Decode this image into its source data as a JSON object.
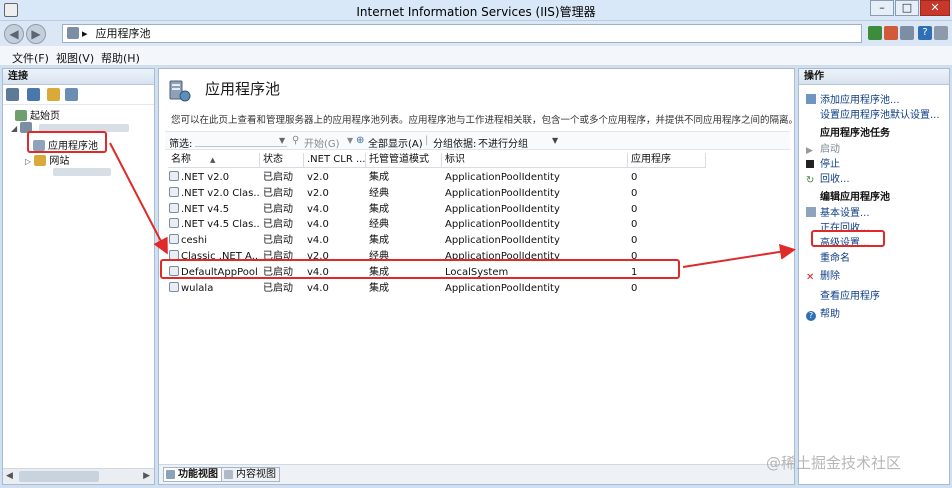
{
  "window": {
    "title": "Internet Information Services (IIS)管理器",
    "min": "–",
    "max": "□",
    "close": "✕"
  },
  "address": {
    "breadcrumb_sep": "▸",
    "path": "应用程序池"
  },
  "menu": [
    "文件(F)",
    "视图(V)",
    "帮助(H)"
  ],
  "connections": {
    "header": "连接",
    "tree": {
      "start_page": "起始页",
      "app_pools": "应用程序池",
      "sites": "网站"
    }
  },
  "main": {
    "title": "应用程序池",
    "description": "您可以在此页上查看和管理服务器上的应用程序池列表。应用程序池与工作进程相关联，包含一个或多个应用程序，并提供不同应用程序之间的隔离。",
    "filter": {
      "label": "筛选:",
      "start": "开始(G)",
      "show_all": "全部显示(A)",
      "group_by_label": "分组依据:",
      "group_by_value": "不进行分组"
    },
    "columns": [
      "名称",
      "状态",
      ".NET CLR ...",
      "托管管道模式",
      "标识",
      "应用程序"
    ],
    "rows": [
      {
        "name": ".NET v2.0",
        "status": "已启动",
        "clr": "v2.0",
        "pipeline": "集成",
        "identity": "ApplicationPoolIdentity",
        "apps": "0"
      },
      {
        "name": ".NET v2.0 Clas...",
        "status": "已启动",
        "clr": "v2.0",
        "pipeline": "经典",
        "identity": "ApplicationPoolIdentity",
        "apps": "0"
      },
      {
        "name": ".NET v4.5",
        "status": "已启动",
        "clr": "v4.0",
        "pipeline": "集成",
        "identity": "ApplicationPoolIdentity",
        "apps": "0"
      },
      {
        "name": ".NET v4.5 Clas...",
        "status": "已启动",
        "clr": "v4.0",
        "pipeline": "经典",
        "identity": "ApplicationPoolIdentity",
        "apps": "0"
      },
      {
        "name": "ceshi",
        "status": "已启动",
        "clr": "v4.0",
        "pipeline": "集成",
        "identity": "ApplicationPoolIdentity",
        "apps": "0"
      },
      {
        "name": "Classic .NET A...",
        "status": "已启动",
        "clr": "v2.0",
        "pipeline": "经典",
        "identity": "ApplicationPoolIdentity",
        "apps": "0"
      },
      {
        "name": "DefaultAppPool",
        "status": "已启动",
        "clr": "v4.0",
        "pipeline": "集成",
        "identity": "LocalSystem",
        "apps": "1"
      },
      {
        "name": "wulala",
        "status": "已启动",
        "clr": "v4.0",
        "pipeline": "集成",
        "identity": "ApplicationPoolIdentity",
        "apps": "0"
      }
    ],
    "tabs": {
      "features": "功能视图",
      "content": "内容视图"
    }
  },
  "actions": {
    "header": "操作",
    "add_pool": "添加应用程序池...",
    "set_defaults": "设置应用程序池默认设置...",
    "tasks_heading": "应用程序池任务",
    "start": "启动",
    "stop": "停止",
    "recycle": "回收...",
    "edit_heading": "编辑应用程序池",
    "basic_settings": "基本设置...",
    "recycling": "正在回收...",
    "advanced_settings": "高级设置...",
    "rename": "重命名",
    "remove": "删除",
    "view_apps": "查看应用程序",
    "help": "帮助"
  },
  "watermark": "@稀土掘金技术社区",
  "colors": {
    "annotation_red": "#e02a2a",
    "link_blue": "#0f3f87",
    "frame_blue": "#cfe0f3"
  }
}
